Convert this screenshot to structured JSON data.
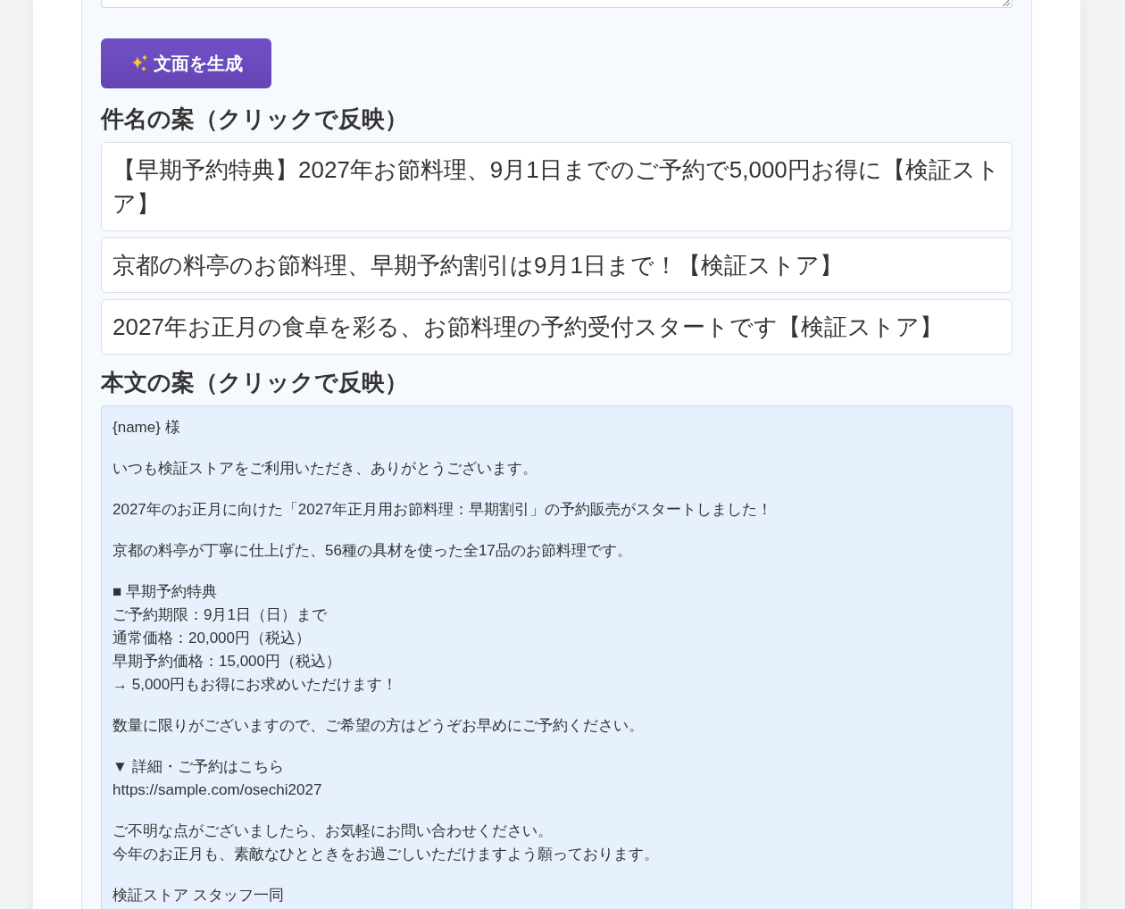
{
  "generate_button": {
    "label": "文面を生成"
  },
  "subjects": {
    "heading": "件名の案（クリックで反映）",
    "options": [
      "【早期予約特典】2027年お節料理、9月1日までのご予約で5,000円お得に【検証ストア】",
      "京都の料亭のお節料理、早期予約割引は9月1日まで！【検証ストア】",
      "2027年お正月の食卓を彩る、お節料理の予約受付スタートです【検証ストア】"
    ]
  },
  "bodies": {
    "heading": "本文の案（クリックで反映）",
    "options": [
      {
        "paragraphs": [
          [
            "{name} 様"
          ],
          [
            "いつも検証ストアをご利用いただき、ありがとうございます。"
          ],
          [
            "2027年のお正月に向けた「2027年正月用お節料理：早期割引」の予約販売がスタートしました！"
          ],
          [
            "京都の料亭が丁寧に仕上げた、56種の具材を使った全17品のお節料理です。"
          ],
          [
            "■ 早期予約特典",
            "ご予約期限：9月1日（日）まで",
            "通常価格：20,000円（税込）",
            "早期予約価格：15,000円（税込）",
            "→ 5,000円もお得にお求めいただけます！"
          ],
          [
            "数量に限りがございますので、ご希望の方はどうぞお早めにご予約ください。"
          ],
          [
            "▼ 詳細・ご予約はこちら",
            "https://sample.com/osechi2027"
          ],
          [
            "ご不明な点がございましたら、お気軽にお問い合わせください。",
            "今年のお正月も、素敵なひとときをお過ごしいただけますよう願っております。"
          ],
          [
            "検証ストア スタッフ一同"
          ]
        ]
      }
    ]
  }
}
